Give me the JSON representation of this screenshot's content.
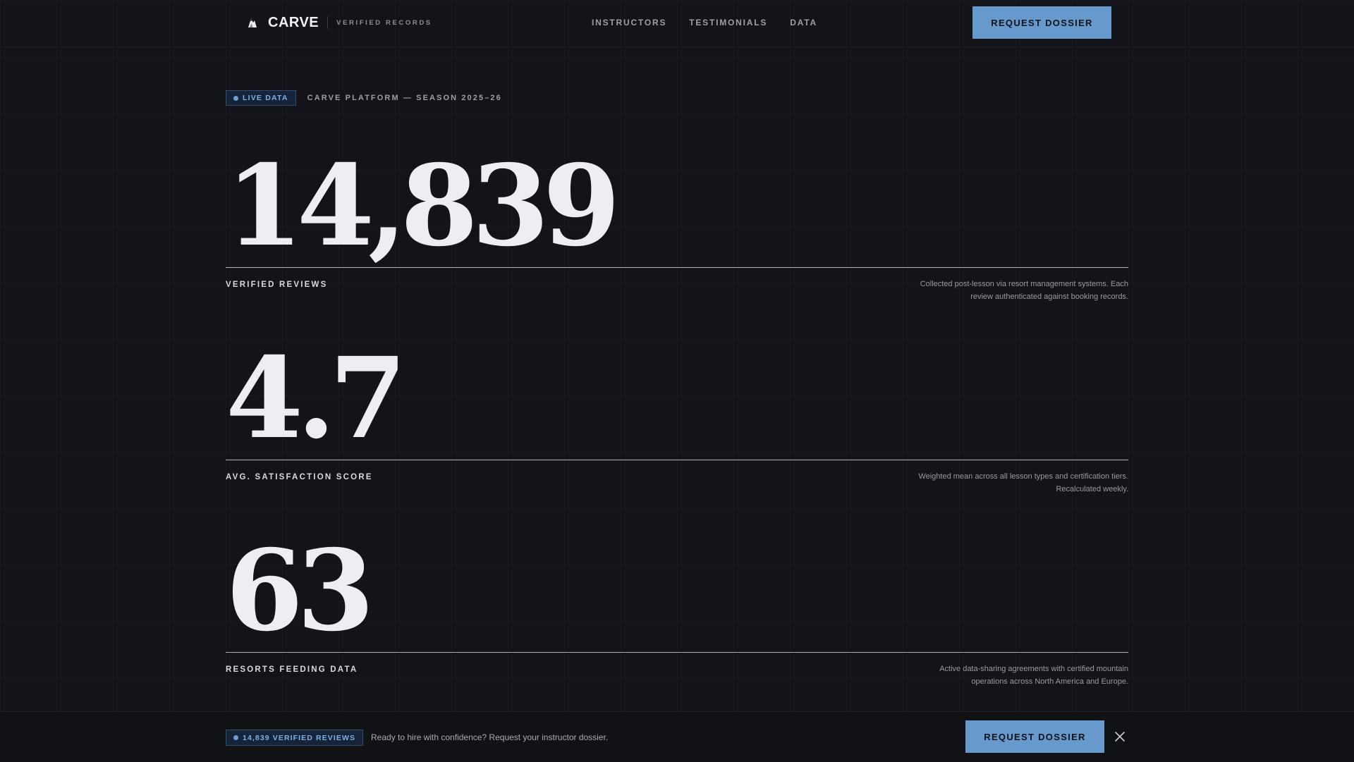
{
  "header": {
    "brand_name": "CARVE",
    "brand_tag": "VERIFIED RECORDS",
    "nav": [
      {
        "label": "INSTRUCTORS"
      },
      {
        "label": "TESTIMONIALS"
      },
      {
        "label": "DATA"
      }
    ],
    "cta_label": "REQUEST DOSSIER",
    "logo_icon": "mountain-logo-icon"
  },
  "meta": {
    "live_badge": "LIVE DATA",
    "context": "CARVE PLATFORM — SEASON 2025–26"
  },
  "stats": [
    {
      "value": "14,839",
      "label": "VERIFIED REVIEWS",
      "desc_line1": "Collected post-lesson via resort management systems. Each",
      "desc_line2": "review authenticated against booking records."
    },
    {
      "value": "4.7",
      "label": "AVG. SATISFACTION SCORE",
      "desc_line1": "Weighted mean across all lesson types and certification tiers.",
      "desc_line2": "Recalculated weekly."
    },
    {
      "value": "63",
      "label": "RESORTS FEEDING DATA",
      "desc_line1": "Active data-sharing agreements with certified mountain",
      "desc_line2": "operations across North America and Europe."
    }
  ],
  "bottom_bar": {
    "badge": "14,839 VERIFIED REVIEWS",
    "text": "Ready to hire with confidence? Request your instructor dossier.",
    "cta_label": "REQUEST DOSSIER",
    "close_icon": "close-icon"
  },
  "colors": {
    "background": "#121419",
    "accent": "#6699cc",
    "badge_text": "#7fb0e3",
    "badge_bg": "#16243a"
  }
}
